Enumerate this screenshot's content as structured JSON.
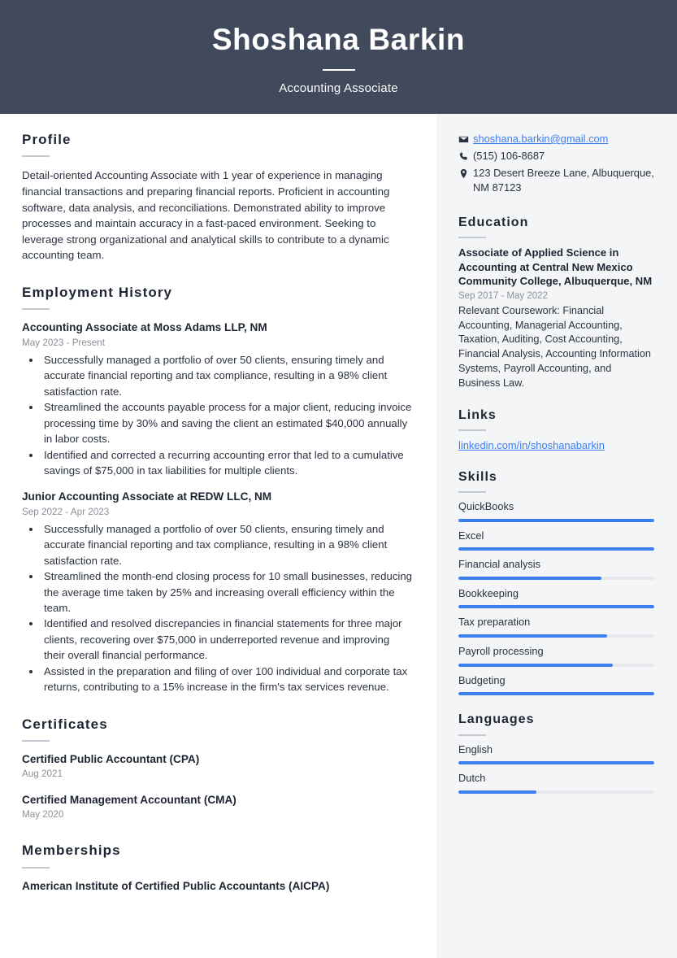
{
  "colors": {
    "header_bg": "#404a5c",
    "sidebar_bg": "#f4f5f7",
    "accent_blue": "#3c7ef0",
    "text_dark": "#1e2532",
    "text_muted": "#8b9099"
  },
  "header": {
    "name": "Shoshana Barkin",
    "job_title": "Accounting Associate"
  },
  "main": {
    "profile": {
      "heading": "Profile",
      "text": "Detail-oriented Accounting Associate with 1 year of experience in managing financial transactions and preparing financial reports. Proficient in accounting software, data analysis, and reconciliations. Demonstrated ability to improve processes and maintain accuracy in a fast-paced environment. Seeking to leverage strong organizational and analytical skills to contribute to a dynamic accounting team."
    },
    "employment": {
      "heading": "Employment History",
      "entries": [
        {
          "title": "Accounting Associate at Moss Adams LLP, NM",
          "date": "May 2023 - Present",
          "bullets": [
            "Successfully managed a portfolio of over 50 clients, ensuring timely and accurate financial reporting and tax compliance, resulting in a 98% client satisfaction rate.",
            "Streamlined the accounts payable process for a major client, reducing invoice processing time by 30% and saving the client an estimated $40,000 annually in labor costs.",
            "Identified and corrected a recurring accounting error that led to a cumulative savings of $75,000 in tax liabilities for multiple clients."
          ]
        },
        {
          "title": "Junior Accounting Associate at REDW LLC, NM",
          "date": "Sep 2022 - Apr 2023",
          "bullets": [
            "Successfully managed a portfolio of over 50 clients, ensuring timely and accurate financial reporting and tax compliance, resulting in a 98% client satisfaction rate.",
            "Streamlined the month-end closing process for 10 small businesses, reducing the average time taken by 25% and increasing overall efficiency within the team.",
            "Identified and resolved discrepancies in financial statements for three major clients, recovering over $75,000 in underreported revenue and improving their overall financial performance.",
            "Assisted in the preparation and filing of over 100 individual and corporate tax returns, contributing to a 15% increase in the firm's tax services revenue."
          ]
        }
      ]
    },
    "certificates": {
      "heading": "Certificates",
      "entries": [
        {
          "title": "Certified Public Accountant (CPA)",
          "date": "Aug 2021"
        },
        {
          "title": "Certified Management Accountant (CMA)",
          "date": "May 2020"
        }
      ]
    },
    "memberships": {
      "heading": "Memberships",
      "entries": [
        {
          "title": "American Institute of Certified Public Accountants (AICPA)"
        }
      ]
    }
  },
  "sidebar": {
    "contact": [
      {
        "icon": "envelope-icon",
        "text": "shoshana.barkin@gmail.com",
        "is_link": true
      },
      {
        "icon": "phone-icon",
        "text": "(515) 106-8687",
        "is_link": false
      },
      {
        "icon": "map-pin-icon",
        "text": "123 Desert Breeze Lane, Albuquerque, NM 87123",
        "is_link": false
      }
    ],
    "education": {
      "heading": "Education",
      "entries": [
        {
          "title": "Associate of Applied Science in Accounting at Central New Mexico Community College, Albuquerque, NM",
          "date": "Sep 2017 - May 2022",
          "description": "Relevant Coursework: Financial Accounting, Managerial Accounting, Taxation, Auditing, Cost Accounting, Financial Analysis, Accounting Information Systems, Payroll Accounting, and Business Law."
        }
      ]
    },
    "links": {
      "heading": "Links",
      "items": [
        {
          "label": "linkedin.com/in/shoshanabarkin"
        }
      ]
    },
    "skills": {
      "heading": "Skills",
      "items": [
        {
          "label": "QuickBooks",
          "level": 100
        },
        {
          "label": "Excel",
          "level": 100
        },
        {
          "label": "Financial analysis",
          "level": 73
        },
        {
          "label": "Bookkeeping",
          "level": 100
        },
        {
          "label": "Tax preparation",
          "level": 76
        },
        {
          "label": "Payroll processing",
          "level": 79
        },
        {
          "label": "Budgeting",
          "level": 100
        }
      ]
    },
    "languages": {
      "heading": "Languages",
      "items": [
        {
          "label": "English",
          "level": 100
        },
        {
          "label": "Dutch",
          "level": 40
        }
      ]
    }
  }
}
